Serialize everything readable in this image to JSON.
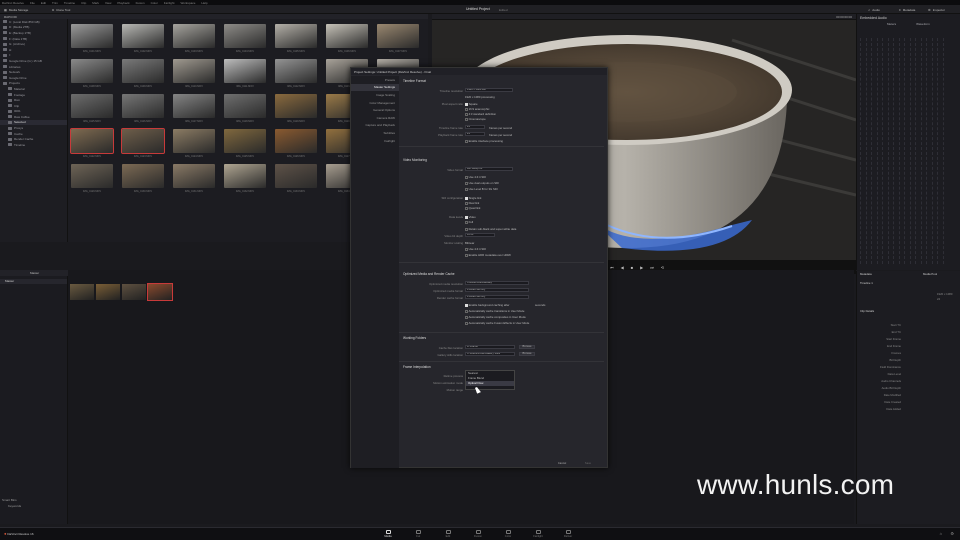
{
  "menubar": [
    "DaVinci Resolve",
    "File",
    "Edit",
    "Trim",
    "Timeline",
    "Clip",
    "Mark",
    "View",
    "Playback",
    "Fusion",
    "Color",
    "Fairlight",
    "Workspace",
    "Help"
  ],
  "toolbar": {
    "media_storage": "Media Storage",
    "clone_tool": "Clone Tool",
    "project_title": "Untitled Project",
    "project_sub": "Edited",
    "timecode": "00:00:00:00",
    "embedded_audio": "Embedded Audio",
    "audio": "Audio",
    "metadata": "Metadata",
    "inspector": "Inspector",
    "media_pool": "Media Pool"
  },
  "bin_tree": {
    "header": "RAPCOD",
    "items": [
      "C: (Local Disk 850 GB)",
      "D: (Media 2TB)",
      "E: (Backup 1TB)",
      "F: (Data 1TB)",
      "G: (Archive)",
      "H:",
      "I:",
      "Google Drive (G:) 15 GB",
      "Libraries",
      "Network",
      "Google Drive",
      "Projects",
      "Material",
      "Footage",
      "Rsm",
      "Clip",
      "0001",
      "Raw Coffee",
      "Selected",
      "Proxys",
      "Cache",
      "Render Cache",
      "Timeline"
    ],
    "selected_index": 18
  },
  "media_thumbs": [
    {
      "cap": "IMG_0101.MOV",
      "color": "#9a9a9a"
    },
    {
      "cap": "IMG_0102.MOV",
      "color": "#b8b8b4"
    },
    {
      "cap": "IMG_0103.MOV",
      "color": "#a6a49e"
    },
    {
      "cap": "IMG_0104.MOV",
      "color": "#8e8c88"
    },
    {
      "cap": "IMG_0105.MOV",
      "color": "#b4b0a8"
    },
    {
      "cap": "IMG_0106.MOV",
      "color": "#c6c2b8"
    },
    {
      "cap": "IMG_0107.MOV",
      "color": "#9a8870"
    },
    {
      "cap": "IMG_0108.MOV",
      "color": "#8a8a8a"
    },
    {
      "cap": "IMG_0109.MOV",
      "color": "#7a7a7a"
    },
    {
      "cap": "IMG_0110.MOV",
      "color": "#a09a90"
    },
    {
      "cap": "IMG_0111.MOV",
      "color": "#bdbdbd"
    },
    {
      "cap": "IMG_0112.MOV",
      "color": "#949494"
    },
    {
      "cap": "IMG_0113.MOV",
      "color": "#a9a39a"
    },
    {
      "cap": "IMG_0114.MOV",
      "color": "#afaaa2"
    },
    {
      "cap": "IMG_0115.MOV",
      "color": "#6d6d6d"
    },
    {
      "cap": "IMG_0116.MOV",
      "color": "#767676"
    },
    {
      "cap": "IMG_0117.MOV",
      "color": "#858585"
    },
    {
      "cap": "IMG_0118.MOV",
      "color": "#6f6f6f"
    },
    {
      "cap": "IMG_0119.MOV",
      "color": "#8a6a3e"
    },
    {
      "cap": "IMG_0120.MOV",
      "color": "#9a7a48"
    },
    {
      "cap": "IMG_0121.MOV",
      "color": "#927854"
    },
    {
      "cap": "IMG_0122.MOV",
      "color": "#7e6a50"
    },
    {
      "cap": "IMG_0123.MOV",
      "color": "#6e5e4a"
    },
    {
      "cap": "IMG_0124.MOV",
      "color": "#8c7c64"
    },
    {
      "cap": "IMG_0125.MOV",
      "color": "#80683e"
    },
    {
      "cap": "IMG_0126.MOV",
      "color": "#8a5a30"
    },
    {
      "cap": "IMG_0127.MOV",
      "color": "#92703e"
    },
    {
      "cap": "IMG_0128.MOV",
      "color": "#8e7c5c"
    },
    {
      "cap": "IMG_0129.MOV",
      "color": "#6e6456"
    },
    {
      "cap": "IMG_0130.MOV",
      "color": "#7c6a54"
    },
    {
      "cap": "IMG_0131.MOV",
      "color": "#8a7a66"
    },
    {
      "cap": "IMG_0132.MOV",
      "color": "#b0a692"
    },
    {
      "cap": "IMG_0133.MOV",
      "color": "#5e5248"
    },
    {
      "cap": "IMG_0134.MOV",
      "color": "#a89e90"
    },
    {
      "cap": "IMG_0135.MOV",
      "color": "#9a8e7e"
    }
  ],
  "selected_thumbs": [
    21,
    22
  ],
  "viewer": {
    "playback_controls": [
      "⏮",
      "◀",
      "■",
      "▶",
      "⏭",
      "⟲"
    ]
  },
  "audio_panel": {
    "tabs": [
      "Meters",
      "Waveform"
    ]
  },
  "metadata_panel": {
    "header": "Metadata",
    "media_pool_label": "Media Pool",
    "timeline_label": "Timeline 1",
    "resolution": "1920 x 1080",
    "fps": "24",
    "clip_details": "Clip Details",
    "rows": [
      "Start TC",
      "End TC",
      "Start Frame",
      "End Frame",
      "Frames",
      "Bit Depth",
      "Field Dominance",
      "Data Level",
      "Audio Channels",
      "Audio Bit Depth",
      "Date Modified",
      "Date Created",
      "Date Added"
    ]
  },
  "timeline_bin": {
    "header": "Master",
    "tl_label": "Master",
    "clips": [
      {
        "color": "#6a5a40"
      },
      {
        "color": "#7a5e36"
      },
      {
        "color": "#5e5040"
      },
      {
        "color": "#8a4a2e"
      }
    ],
    "smart_bins": "Smart Bins",
    "keywords": "Keywords"
  },
  "dialog": {
    "title": "Project Settings: Untitled Project (DaVinci Resolve) - Final",
    "nav": [
      "Presets",
      "Master Settings",
      "Image Scaling",
      "Color Management",
      "General Options",
      "Camera RAW",
      "Capture and Playback",
      "Subtitles",
      "Fairlight"
    ],
    "nav_selected": 1,
    "timeline_format": {
      "title": "Timeline Format",
      "resolution_label": "Timeline resolution",
      "resolution_value": "1920 x 1080 HD",
      "resolution_sub": "1920 x 1080 processing",
      "pixel_aspect_label": "Pixel aspect ratio",
      "pixel_opts": [
        "Square",
        "16:9 anamorphic",
        "4:3 standard definition",
        "Cinemascope"
      ],
      "fps_label": "Timeline frame rate",
      "fps_value": "24",
      "fps_note": "frames per second",
      "playback_label": "Playback frame rate",
      "playback_value": "24",
      "playback_note": "frames per second",
      "drop_frame": "Enable interlace processing"
    },
    "video_monitoring": {
      "title": "Video Monitoring",
      "format_label": "Video format",
      "format_value": "HD 1080p 24",
      "sdi_label": "SDI configuration",
      "sdi_opts": [
        "Single link",
        "Dual link",
        "Quad link"
      ],
      "checks": [
        "Use 4:4:4 SDI",
        "Use dual outputs on SDI",
        "Use Level B for 3G SDI"
      ],
      "data_label": "Data levels",
      "data_opts": [
        "Video",
        "Full"
      ],
      "retain": "Retain sub-black and super-white data",
      "bitdepth_label": "Video bit depth",
      "bitdepth_value": "10 bit",
      "monitor_label": "Monitor scaling",
      "monitor_value": "Bilinear",
      "extras": [
        "Use 4:4:4 SDI",
        "Enable HDR metadata over HDMI"
      ]
    },
    "optimized": {
      "title": "Optimized Media and Render Cache",
      "res_label": "Optimized media resolution",
      "res_value": "Choose Automatically",
      "fmt_label": "Optimized media format",
      "fmt_value": "ProRes 422 HQ",
      "cache_label": "Render cache format",
      "cache_value": "ProRes 422 HQ",
      "checks": [
        "Enable background caching after",
        "Automatically cache transitions in User Mode",
        "Automatically cache composites in User Mode",
        "Automatically cache Fusion Effects in User Mode"
      ],
      "seconds": "seconds"
    },
    "working": {
      "title": "Working Folders",
      "cache_label": "Cache files location",
      "cache_value": "D:\\Cache",
      "gallery_label": "Gallery stills location",
      "gallery_value": "C:\\Users\\Public\\Gallery Stills",
      "browse": "Browse"
    },
    "frame_interp": {
      "title": "Frame Interpolation",
      "retime_label": "Retime process",
      "retime_value": "Nearest",
      "motion_label": "Motion estimation mode",
      "motion_value": "Standard Faster",
      "range_label": "Motion range"
    },
    "dropdown_opts": [
      "Nearest",
      "Frame Blend",
      "Optical Flow"
    ],
    "dropdown_highlight": 2,
    "cancel": "Cancel",
    "save": "Save"
  },
  "pagebar": {
    "app": "DaVinci Resolve 16",
    "pages": [
      "Media",
      "Cut",
      "Edit",
      "Fusion",
      "Color",
      "Fairlight",
      "Deliver"
    ],
    "active": 0
  },
  "watermark": "www.hunls.com"
}
